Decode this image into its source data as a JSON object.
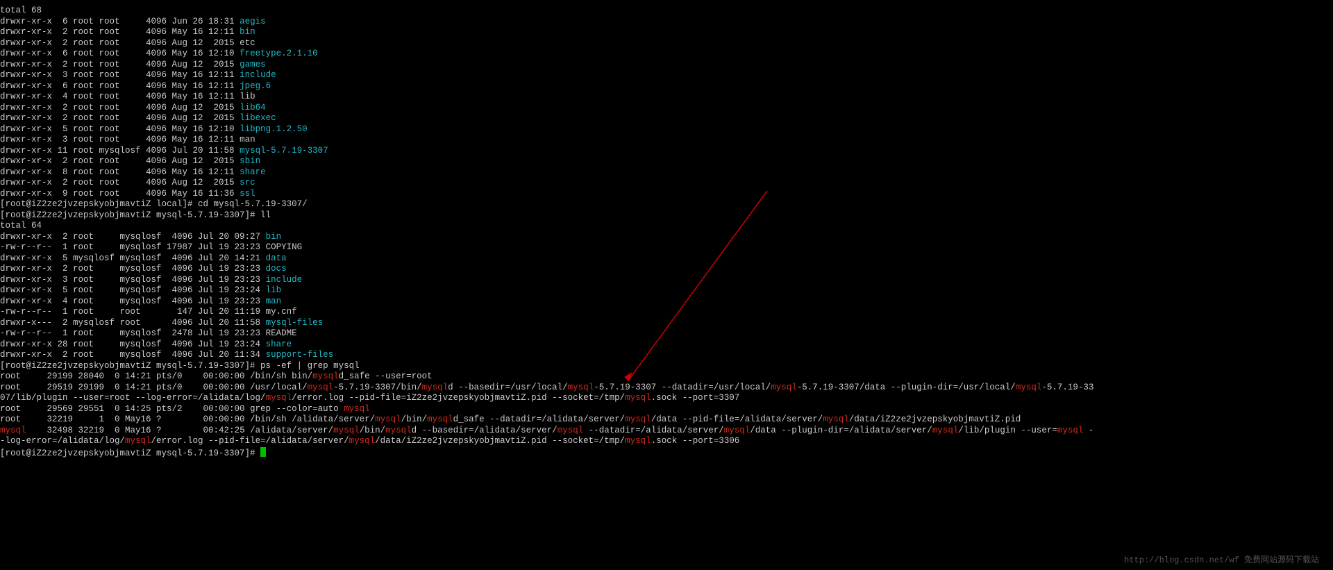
{
  "top_total": "total 68",
  "ls_local": [
    {
      "meta": "drwxr-xr-x  6 root root     4096 Jun 26 18:31 ",
      "name": "aegis",
      "cls": "cyan"
    },
    {
      "meta": "drwxr-xr-x  2 root root     4096 May 16 12:11 ",
      "name": "bin",
      "cls": "cyan"
    },
    {
      "meta": "drwxr-xr-x  2 root root     4096 Aug 12  2015 ",
      "name": "etc",
      "cls": ""
    },
    {
      "meta": "drwxr-xr-x  6 root root     4096 May 16 12:10 ",
      "name": "freetype.2.1.10",
      "cls": "cyan"
    },
    {
      "meta": "drwxr-xr-x  2 root root     4096 Aug 12  2015 ",
      "name": "games",
      "cls": "cyan"
    },
    {
      "meta": "drwxr-xr-x  3 root root     4096 May 16 12:11 ",
      "name": "include",
      "cls": "cyan"
    },
    {
      "meta": "drwxr-xr-x  6 root root     4096 May 16 12:11 ",
      "name": "jpeg.6",
      "cls": "cyan"
    },
    {
      "meta": "drwxr-xr-x  4 root root     4096 May 16 12:11 ",
      "name": "lib",
      "cls": ""
    },
    {
      "meta": "drwxr-xr-x  2 root root     4096 Aug 12  2015 ",
      "name": "lib64",
      "cls": "cyan"
    },
    {
      "meta": "drwxr-xr-x  2 root root     4096 Aug 12  2015 ",
      "name": "libexec",
      "cls": "cyan"
    },
    {
      "meta": "drwxr-xr-x  5 root root     4096 May 16 12:10 ",
      "name": "libpng.1.2.50",
      "cls": "cyan"
    },
    {
      "meta": "drwxr-xr-x  3 root root     4096 May 16 12:11 ",
      "name": "man",
      "cls": ""
    },
    {
      "meta": "drwxr-xr-x 11 root mysqlosf 4096 Jul 20 11:58 ",
      "name": "mysql-5.7.19-3307",
      "cls": "cyan"
    },
    {
      "meta": "drwxr-xr-x  2 root root     4096 Aug 12  2015 ",
      "name": "sbin",
      "cls": "cyan"
    },
    {
      "meta": "drwxr-xr-x  8 root root     4096 May 16 12:11 ",
      "name": "share",
      "cls": "cyan"
    },
    {
      "meta": "drwxr-xr-x  2 root root     4096 Aug 12  2015 ",
      "name": "src",
      "cls": "cyan"
    },
    {
      "meta": "drwxr-xr-x  9 root root     4096 May 16 11:36 ",
      "name": "ssl",
      "cls": "cyan"
    }
  ],
  "prompt_cd": "[root@iZ2ze2jvzepskyobjmavtiZ local]# cd mysql-5.7.19-3307/",
  "prompt_ll": "[root@iZ2ze2jvzepskyobjmavtiZ mysql-5.7.19-3307]# ll",
  "sub_total": "total 64",
  "ls_mysql": [
    {
      "meta": "drwxr-xr-x  2 root     mysqlosf  4096 Jul 20 09:27 ",
      "name": "bin",
      "cls": "cyan"
    },
    {
      "meta": "-rw-r--r--  1 root     mysqlosf 17987 Jul 19 23:23 ",
      "name": "COPYING",
      "cls": ""
    },
    {
      "meta": "drwxr-xr-x  5 mysqlosf mysqlosf  4096 Jul 20 14:21 ",
      "name": "data",
      "cls": "cyan"
    },
    {
      "meta": "drwxr-xr-x  2 root     mysqlosf  4096 Jul 19 23:23 ",
      "name": "docs",
      "cls": "cyan"
    },
    {
      "meta": "drwxr-xr-x  3 root     mysqlosf  4096 Jul 19 23:23 ",
      "name": "include",
      "cls": "cyan"
    },
    {
      "meta": "drwxr-xr-x  5 root     mysqlosf  4096 Jul 19 23:24 ",
      "name": "lib",
      "cls": "cyan"
    },
    {
      "meta": "drwxr-xr-x  4 root     mysqlosf  4096 Jul 19 23:23 ",
      "name": "man",
      "cls": "cyan"
    },
    {
      "meta": "-rw-r--r--  1 root     root       147 Jul 20 11:19 ",
      "name": "my.cnf",
      "cls": ""
    },
    {
      "meta": "drwxr-x---  2 mysqlosf root      4096 Jul 20 11:58 ",
      "name": "mysql-files",
      "cls": "cyan"
    },
    {
      "meta": "-rw-r--r--  1 root     mysqlosf  2478 Jul 19 23:23 ",
      "name": "README",
      "cls": ""
    },
    {
      "meta": "drwxr-xr-x 28 root     mysqlosf  4096 Jul 19 23:24 ",
      "name": "share",
      "cls": "cyan"
    },
    {
      "meta": "drwxr-xr-x  2 root     mysqlosf  4096 Jul 20 11:34 ",
      "name": "support-files",
      "cls": "cyan"
    }
  ],
  "prompt_ps": "[root@iZ2ze2jvzepskyobjmavtiZ mysql-5.7.19-3307]# ps -ef | grep mysql",
  "ps_rows": [
    [
      {
        "t": "root     29199 28040  0 14:21 pts/0    00:00:00 /bin/sh bin/"
      },
      {
        "t": "mysql",
        "c": "red"
      },
      {
        "t": "d_safe --user=root"
      }
    ],
    [
      {
        "t": "root     29519 29199  0 14:21 pts/0    00:00:00 /usr/local/"
      },
      {
        "t": "mysql",
        "c": "red"
      },
      {
        "t": "-5.7.19-3307/bin/"
      },
      {
        "t": "mysql",
        "c": "red"
      },
      {
        "t": "d --basedir=/usr/local/"
      },
      {
        "t": "mysql",
        "c": "red"
      },
      {
        "t": "-5.7.19-3307 --datadir=/usr/local/"
      },
      {
        "t": "mysql",
        "c": "red"
      },
      {
        "t": "-5.7.19-3307/data --plugin-dir=/usr/local/"
      },
      {
        "t": "mysql",
        "c": "red"
      },
      {
        "t": "-5.7.19-33"
      }
    ],
    [
      {
        "t": "07/lib/plugin --user=root --log-error=/alidata/log/"
      },
      {
        "t": "mysql",
        "c": "red"
      },
      {
        "t": "/error.log --pid-file=iZ2ze2jvzepskyobjmavtiZ.pid --socket=/tmp/"
      },
      {
        "t": "mysql",
        "c": "red"
      },
      {
        "t": ".sock --port=3307"
      }
    ],
    [
      {
        "t": "root     29569 29551  0 14:25 pts/2    00:00:00 grep --color=auto "
      },
      {
        "t": "mysql",
        "c": "red"
      }
    ],
    [
      {
        "t": "root     32219     1  0 May16 ?        00:00:00 /bin/sh /alidata/server/"
      },
      {
        "t": "mysql",
        "c": "red"
      },
      {
        "t": "/bin/"
      },
      {
        "t": "mysql",
        "c": "red"
      },
      {
        "t": "d_safe --datadir=/alidata/server/"
      },
      {
        "t": "mysql",
        "c": "red"
      },
      {
        "t": "/data --pid-file=/alidata/server/"
      },
      {
        "t": "mysql",
        "c": "red"
      },
      {
        "t": "/data/iZ2ze2jvzepskyobjmavtiZ.pid"
      }
    ],
    [
      {
        "t": "mysql",
        "c": "red"
      },
      {
        "t": "    32498 32219  0 May16 ?        00:42:25 /alidata/server/"
      },
      {
        "t": "mysql",
        "c": "red"
      },
      {
        "t": "/bin/"
      },
      {
        "t": "mysql",
        "c": "red"
      },
      {
        "t": "d --basedir=/alidata/server/"
      },
      {
        "t": "mysql",
        "c": "red"
      },
      {
        "t": " --datadir=/alidata/server/"
      },
      {
        "t": "mysql",
        "c": "red"
      },
      {
        "t": "/data --plugin-dir=/alidata/server/"
      },
      {
        "t": "mysql",
        "c": "red"
      },
      {
        "t": "/lib/plugin --user="
      },
      {
        "t": "mysql",
        "c": "red"
      },
      {
        "t": " -"
      }
    ],
    [
      {
        "t": "-log-error=/alidata/log/"
      },
      {
        "t": "mysql",
        "c": "red"
      },
      {
        "t": "/error.log --pid-file=/alidata/server/"
      },
      {
        "t": "mysql",
        "c": "red"
      },
      {
        "t": "/data/iZ2ze2jvzepskyobjmavtiZ.pid --socket=/tmp/"
      },
      {
        "t": "mysql",
        "c": "red"
      },
      {
        "t": ".sock --port=3306"
      }
    ]
  ],
  "prompt_end": "[root@iZ2ze2jvzepskyobjmavtiZ mysql-5.7.19-3307]# ",
  "watermark": "http://blog.csdn.net/wf 免费网站源码下载站"
}
